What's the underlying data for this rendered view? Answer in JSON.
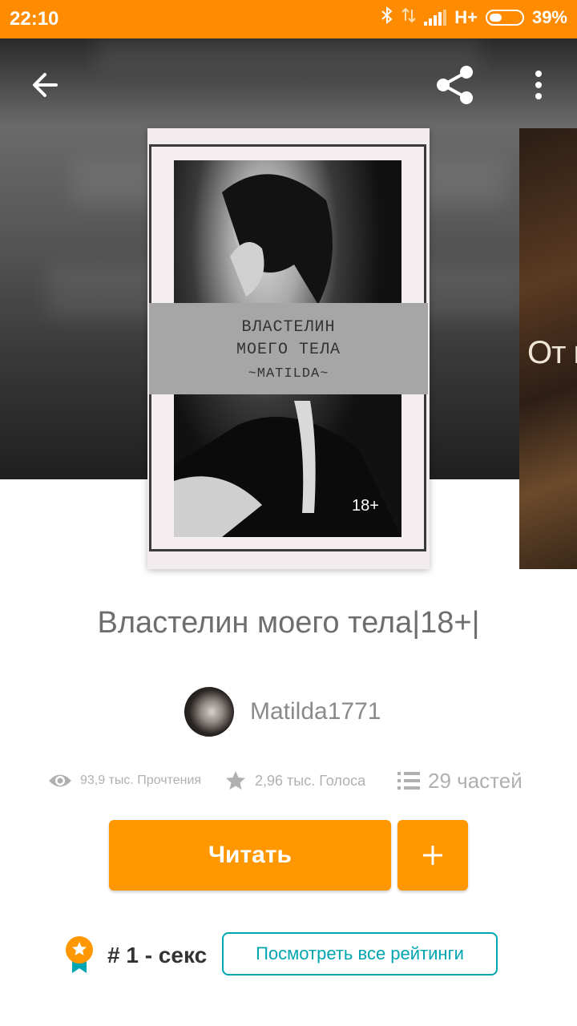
{
  "status_bar": {
    "time": "22:10",
    "network": "H+",
    "battery": "39%",
    "battery_level": 0.39
  },
  "header": {
    "back_icon": "arrow-left-icon",
    "share_icon": "share-icon",
    "more_icon": "more-vertical-icon"
  },
  "cover": {
    "title_line1": "ВЛАСТЕЛИН",
    "title_line2": "МОЕГО ТЕЛА",
    "author_line": "~MATILDA~",
    "age": "18+"
  },
  "next_cover": {
    "text": "От в"
  },
  "story": {
    "title": "Властелин моего тела|18+|",
    "author": "Matilda1771"
  },
  "stats": {
    "views": "93,9 тыс. Прочтения",
    "votes": "2,96 тыс. Голоса",
    "parts": "29 частей"
  },
  "actions": {
    "read_label": "Читать",
    "add_icon": "plus-icon"
  },
  "ranking": {
    "rank_label": "# 1 - секс",
    "all_ratings_label": "Посмотреть все рейтинги"
  },
  "colors": {
    "status_bar": "#ff8c00",
    "accent": "#ff9800",
    "link": "#00a5b2"
  }
}
